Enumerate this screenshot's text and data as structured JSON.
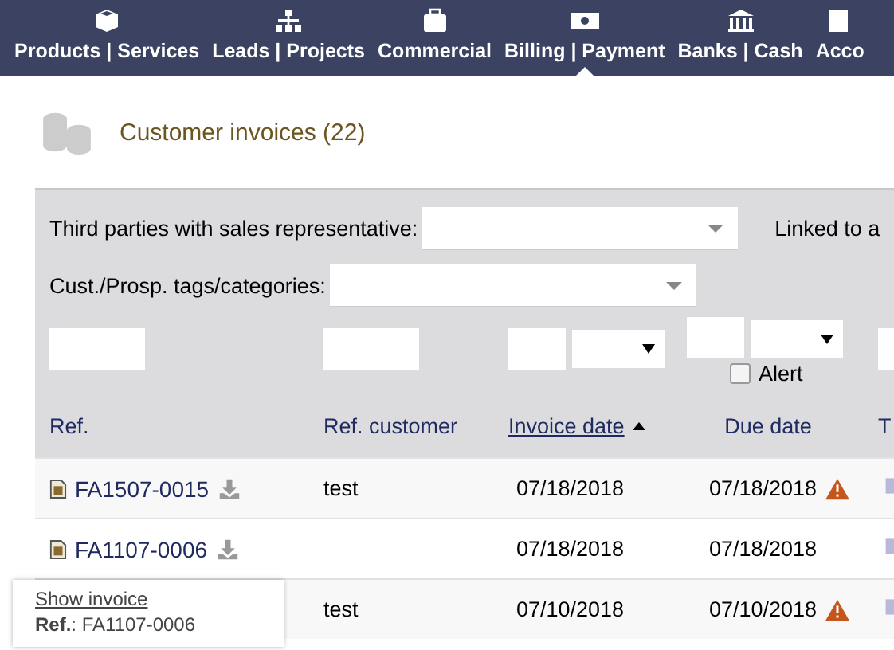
{
  "menu": [
    {
      "label": "Products | Services",
      "selected": false
    },
    {
      "label": "Leads | Projects",
      "selected": false
    },
    {
      "label": "Commercial",
      "selected": false
    },
    {
      "label": "Billing | Payment",
      "selected": true
    },
    {
      "label": "Banks | Cash",
      "selected": false
    },
    {
      "label": "Acco",
      "selected": false
    }
  ],
  "page_title": "Customer invoices (22)",
  "filters": [
    {
      "label": "Third parties with sales representative:"
    },
    {
      "label": "Cust./Prosp. tags/categories:"
    }
  ],
  "filter_cut_label": "Linked to a",
  "alert_filter": {
    "label": "Alert",
    "checked": false
  },
  "columns": [
    {
      "label": "Ref.",
      "sorted": false
    },
    {
      "label": "Ref. customer",
      "sorted": false
    },
    {
      "label": "Invoice date",
      "sorted": true
    },
    {
      "label": "Due date",
      "sorted": false
    },
    {
      "label": "T",
      "sorted": false
    }
  ],
  "rows": [
    {
      "ref": "FA1507-0015",
      "ref_customer": "test",
      "invoice_date": "07/18/2018",
      "due_date": "07/18/2018",
      "late": true
    },
    {
      "ref": "FA1107-0006",
      "ref_customer": "",
      "invoice_date": "07/18/2018",
      "due_date": "07/18/2018",
      "late": false
    },
    {
      "ref": "",
      "ref_customer": "test",
      "invoice_date": "07/10/2018",
      "due_date": "07/10/2018",
      "late": true
    }
  ],
  "tooltip": {
    "link": "Show invoice",
    "line": "**Ref.**: FA1107-0006"
  }
}
